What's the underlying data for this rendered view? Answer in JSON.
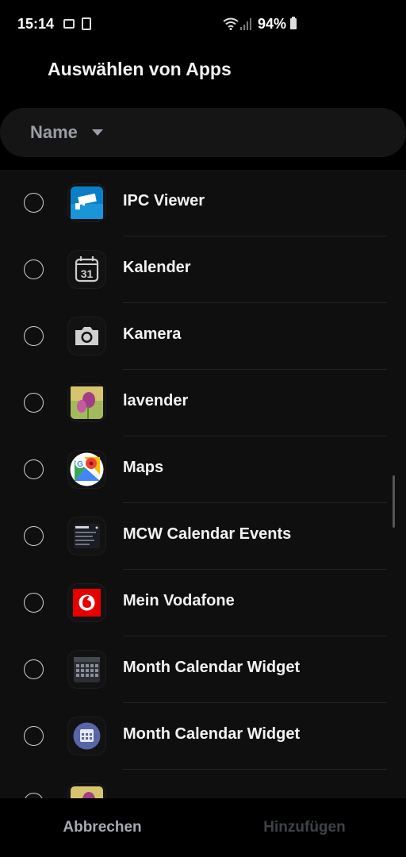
{
  "status_bar": {
    "time": "15:14",
    "battery_percent": "94%",
    "battery_level": 0.94,
    "icons": [
      "image-icon",
      "vibrate-icon",
      "wifi-icon",
      "signal-icon",
      "battery-icon"
    ]
  },
  "header": {
    "title": "Auswählen von Apps"
  },
  "sort": {
    "label": "Name"
  },
  "apps": [
    {
      "name": "IPC Viewer",
      "icon": "ipc-viewer-icon"
    },
    {
      "name": "Kalender",
      "icon": "calendar-icon",
      "icon_text": "31"
    },
    {
      "name": "Kamera",
      "icon": "camera-icon"
    },
    {
      "name": "lavender",
      "icon": "lavender-icon"
    },
    {
      "name": "Maps",
      "icon": "maps-icon"
    },
    {
      "name": "MCW Calendar Events",
      "icon": "mcw-calendar-events-icon"
    },
    {
      "name": "Mein Vodafone",
      "icon": "vodafone-icon"
    },
    {
      "name": "Month Calendar Widget",
      "icon": "month-calendar-widget-icon"
    },
    {
      "name": "Month Calendar Widget",
      "icon": "month-calendar-widget-round-icon"
    }
  ],
  "footer": {
    "cancel_label": "Abbrechen",
    "add_label": "Hinzufügen"
  },
  "colors": {
    "background": "#000000",
    "panel": "#0f0f0f",
    "text": "#f2f2f2",
    "muted": "#9a9ea8",
    "disabled": "#3e4248"
  }
}
